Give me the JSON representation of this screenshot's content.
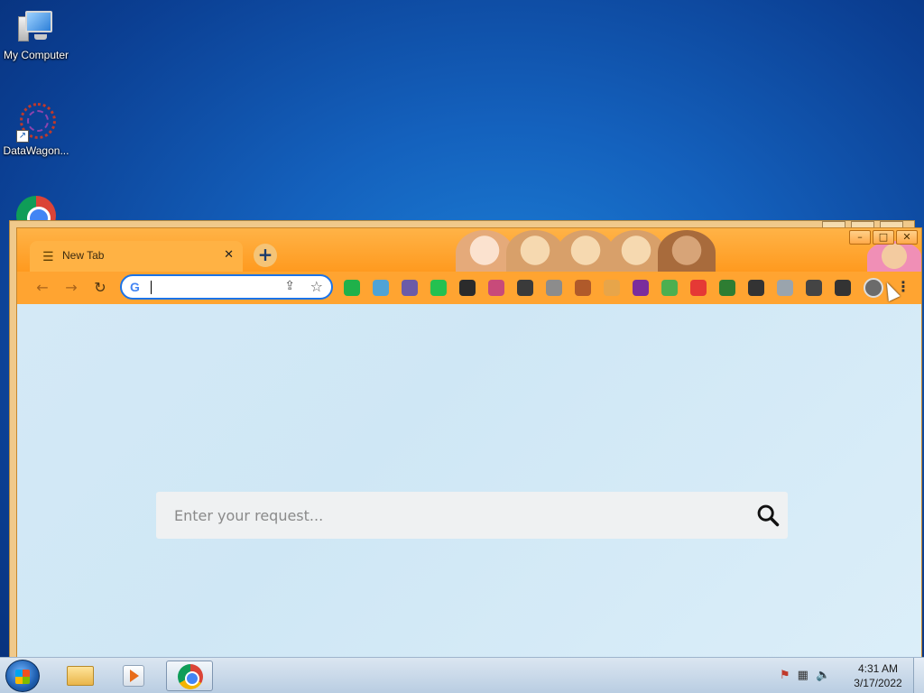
{
  "desktop": {
    "icons": [
      {
        "label": "My Computer",
        "icon": "computer-icon"
      },
      {
        "label": "DataWagon...",
        "icon": "datawagon-icon"
      },
      {
        "label": "",
        "icon": "chrome-icon"
      }
    ]
  },
  "browser": {
    "tab": {
      "title": "New Tab",
      "icon": "tune-icon",
      "close": "✕"
    },
    "new_tab_glyph": "+",
    "window_controls": {
      "minimize": "–",
      "maximize": "□",
      "close": "✕"
    },
    "nav": {
      "back": "←",
      "forward": "→",
      "reload": "↻"
    },
    "omnibox": {
      "value": "",
      "google_glyph": "G"
    },
    "extensions": [
      {
        "name": "meet-extension-icon",
        "color": "#1fb14a"
      },
      {
        "name": "bird-extension-icon",
        "color": "#4fa3d6"
      },
      {
        "name": "monster-extension-icon",
        "color": "#6b5ba8"
      },
      {
        "name": "ring-extension-icon",
        "color": "#24c150"
      },
      {
        "name": "dark-circle-extension-icon",
        "color": "#2b2b2b"
      },
      {
        "name": "car-extension-icon",
        "color": "#c84a7a"
      },
      {
        "name": "avatar-extension-icon",
        "color": "#3a3a3a"
      },
      {
        "name": "grey-o-extension-icon",
        "color": "#8c8c8c"
      },
      {
        "name": "battery-extension-icon",
        "color": "#b05a2a"
      },
      {
        "name": "drop-extension-icon",
        "color": "#e7a54a"
      },
      {
        "name": "pen-extension-icon",
        "color": "#7b2d9c"
      },
      {
        "name": "rainbow-leaf-extension-icon",
        "color": "#4caf50"
      },
      {
        "name": "rainbow-flag-extension-icon",
        "color": "#e53935"
      },
      {
        "name": "globe-extension-icon",
        "color": "#2e7d32"
      },
      {
        "name": "puzzle-plus-extension-icon",
        "color": "#333333"
      },
      {
        "name": "photo-extension-icon",
        "color": "#9aa4ad"
      },
      {
        "name": "extensions-puzzle-icon",
        "color": "#444444"
      },
      {
        "name": "side-panel-icon",
        "color": "#333333"
      }
    ],
    "menu_glyph": "⋮"
  },
  "page": {
    "search_placeholder": "Enter your request..."
  },
  "taskbar": {
    "items": [
      "start-button",
      "explorer-button",
      "media-player-button",
      "chrome-button"
    ],
    "clock_time": "4:31 AM",
    "clock_date": "3/17/2022"
  },
  "colors": {
    "titlebar": "#ff9a1f",
    "content_bg": "#d4e9f6",
    "omnibox_border": "#1a73e8"
  }
}
